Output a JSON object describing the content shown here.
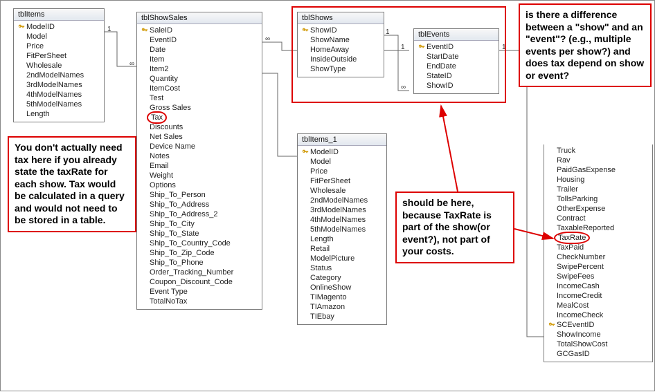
{
  "tables": {
    "tblItems": {
      "title": "tblItems",
      "fields": [
        "ModelID",
        "Model",
        "Price",
        "FitPerSheet",
        "Wholesale",
        "2ndModelNames",
        "3rdModelNames",
        "4thModelNames",
        "5thModelNames",
        "Length"
      ],
      "pk": [
        "ModelID"
      ]
    },
    "tblShowSales": {
      "title": "tblShowSales",
      "fields": [
        "SaleID",
        "EventID",
        "Date",
        "Item",
        "Item2",
        "Quantity",
        "ItemCost",
        "Test",
        "Gross Sales",
        "Tax",
        "Discounts",
        "Net Sales",
        "Device Name",
        "Notes",
        "Email",
        "Weight",
        "Options",
        "Ship_To_Person",
        "Ship_To_Address",
        "Ship_To_Address_2",
        "Ship_To_City",
        "Ship_To_State",
        "Ship_To_Country_Code",
        "Ship_To_Zip_Code",
        "Ship_To_Phone",
        "Order_Tracking_Number",
        "Coupon_Discount_Code",
        "Event Type",
        "TotalNoTax"
      ],
      "pk": [
        "SaleID"
      ],
      "circled": [
        "Tax"
      ]
    },
    "tblShows": {
      "title": "tblShows",
      "fields": [
        "ShowID",
        "ShowName",
        "HomeAway",
        "InsideOutside",
        "ShowType"
      ],
      "pk": [
        "ShowID"
      ]
    },
    "tblEvents": {
      "title": "tblEvents",
      "fields": [
        "EventID",
        "StartDate",
        "EndDate",
        "StateID",
        "ShowID"
      ],
      "pk": [
        "EventID"
      ]
    },
    "tblItems_1": {
      "title": "tblItems_1",
      "fields": [
        "ModelID",
        "Model",
        "Price",
        "FitPerSheet",
        "Wholesale",
        "2ndModelNames",
        "3rdModelNames",
        "4thModelNames",
        "5thModelNames",
        "Length",
        "Retail",
        "ModelPicture",
        "Status",
        "Category",
        "OnlineShow",
        "TIMagento",
        "TIAmazon",
        "TIEbay"
      ],
      "pk": [
        "ModelID"
      ]
    },
    "tblCosts": {
      "title": "",
      "fields": [
        "Truck",
        "Rav",
        "PaidGasExpense",
        "Housing",
        "Trailer",
        "TollsParking",
        "OtherExpense",
        "Contract",
        "TaxableReported",
        "TaxRate",
        "TaxPaid",
        "CheckNumber",
        "SwipePercent",
        "SwipeFees",
        "IncomeCash",
        "IncomeCredit",
        "MealCost",
        "IncomeCheck",
        "SCEventID",
        "ShowIncome",
        "TotalShowCost",
        "GCGasID"
      ],
      "pk": [
        "SCEventID"
      ],
      "circled": [
        "TaxRate"
      ]
    }
  },
  "annotations": {
    "left": "You don't actually need tax here if you already state the taxRate for each show. Tax would be calculated in a query and would not need to be stored in a table.",
    "mid": "should be here, because TaxRate is part of the show(or event?), not part of your costs.",
    "right": "is there a difference between a \"show\" and an \"event\"? (e.g., multiple events per show?) and does tax depend on show or event?"
  },
  "rel_labels": {
    "one": "1",
    "many": "∞"
  },
  "icons": {
    "pk": "primary-key"
  }
}
